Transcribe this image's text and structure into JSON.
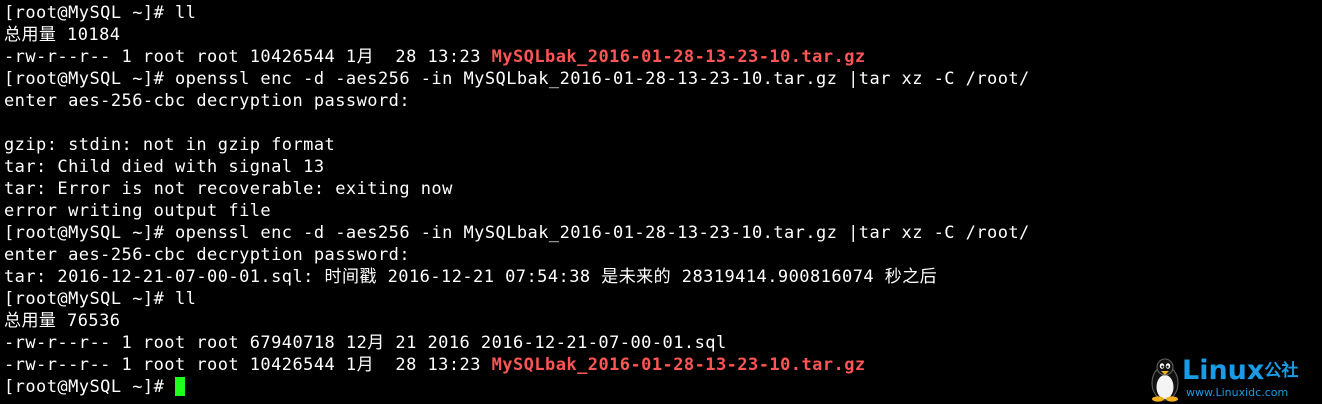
{
  "terminal": {
    "lines": [
      "[root@MySQL ~]# ll",
      "总用量 10184",
      "-rw-r--r-- 1 root root 10426544 1月  28 13:23 ",
      "[root@MySQL ~]# openssl enc -d -aes256 -in MySQLbak_2016-01-28-13-23-10.tar.gz |tar xz -C /root/",
      "enter aes-256-cbc decryption password:",
      "",
      "gzip: stdin: not in gzip format",
      "tar: Child died with signal 13",
      "tar: Error is not recoverable: exiting now",
      "error writing output file",
      "[root@MySQL ~]# openssl enc -d -aes256 -in MySQLbak_2016-01-28-13-23-10.tar.gz |tar xz -C /root/",
      "enter aes-256-cbc decryption password:",
      "tar: 2016-12-21-07-00-01.sql: 时间戳 2016-12-21 07:54:38 是未来的 28319414.900816074 秒之后",
      "[root@MySQL ~]# ll",
      "总用量 76536",
      "-rw-r--r-- 1 root root 67940718 12月 21 2016 2016-12-21-07-00-01.sql",
      "-rw-r--r-- 1 root root 10426544 1月  28 13:23 ",
      "[root@MySQL ~]# "
    ],
    "highlighted_files": {
      "line3": "MySQLbak_2016-01-28-13-23-10.tar.gz",
      "line17": "MySQLbak_2016-01-28-13-23-10.tar.gz"
    },
    "colors": {
      "background": "#000000",
      "text": "#ffffff",
      "archive_file": "#ff5555",
      "cursor": "#1eff1e"
    }
  },
  "watermark": {
    "brand": "Linux",
    "brand_cn": "公社",
    "url": "www.Linuxidc.com",
    "icon": "tux-penguin-icon",
    "color": "#1a9be6"
  }
}
